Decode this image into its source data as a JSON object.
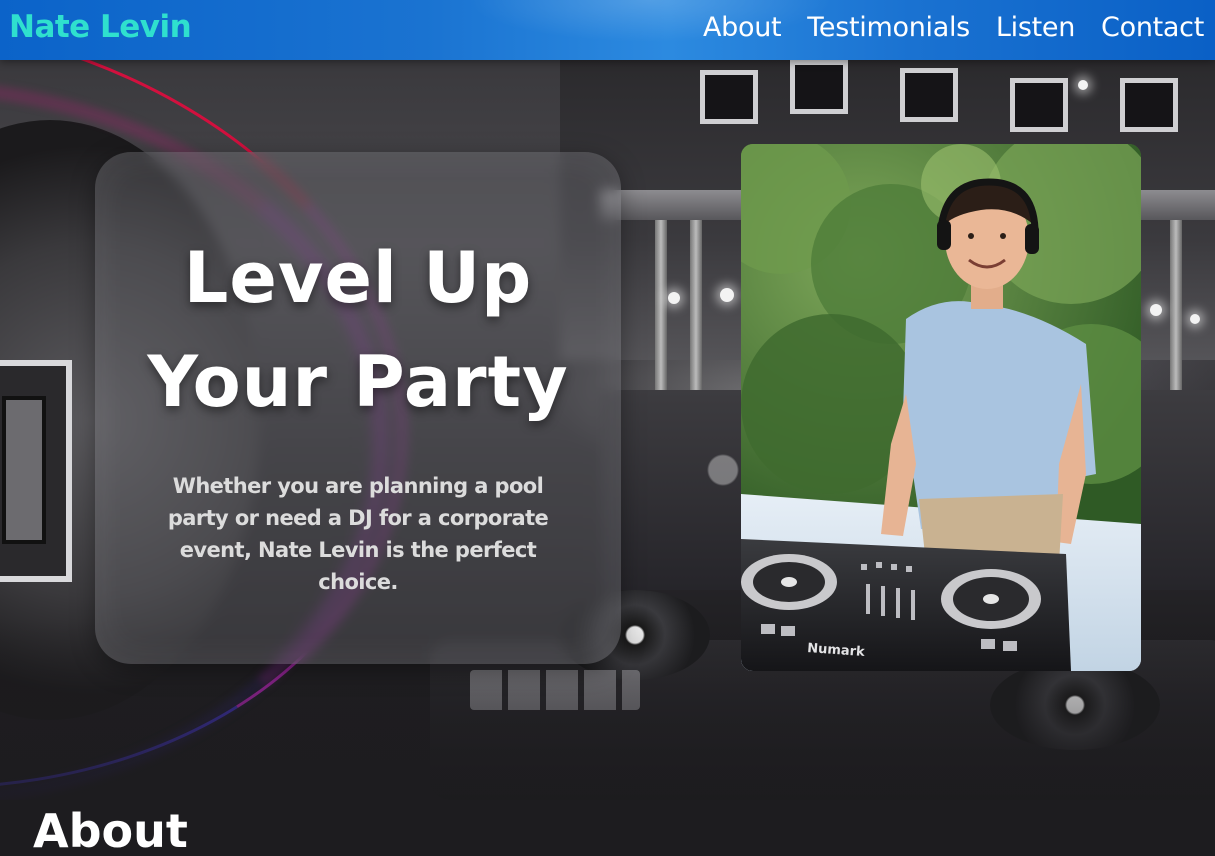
{
  "header": {
    "logo": "Nate Levin",
    "nav": [
      {
        "label": "About"
      },
      {
        "label": "Testimonials"
      },
      {
        "label": "Listen"
      },
      {
        "label": "Contact"
      }
    ]
  },
  "hero": {
    "title_line1": "Level Up",
    "title_line2": "Your Party",
    "subtitle": "Whether you are planning a pool party or need a DJ for a corporate event, Nate Levin is the perfect choice.",
    "photo_brand_text": "Numark"
  },
  "about": {
    "heading": "About"
  },
  "colors": {
    "header_blue": "#1a73d1",
    "logo_teal": "#2fe0ce",
    "page_bg": "#1d1c1f",
    "ring_red": "#d2103e",
    "ring_purple": "#a224a4"
  }
}
